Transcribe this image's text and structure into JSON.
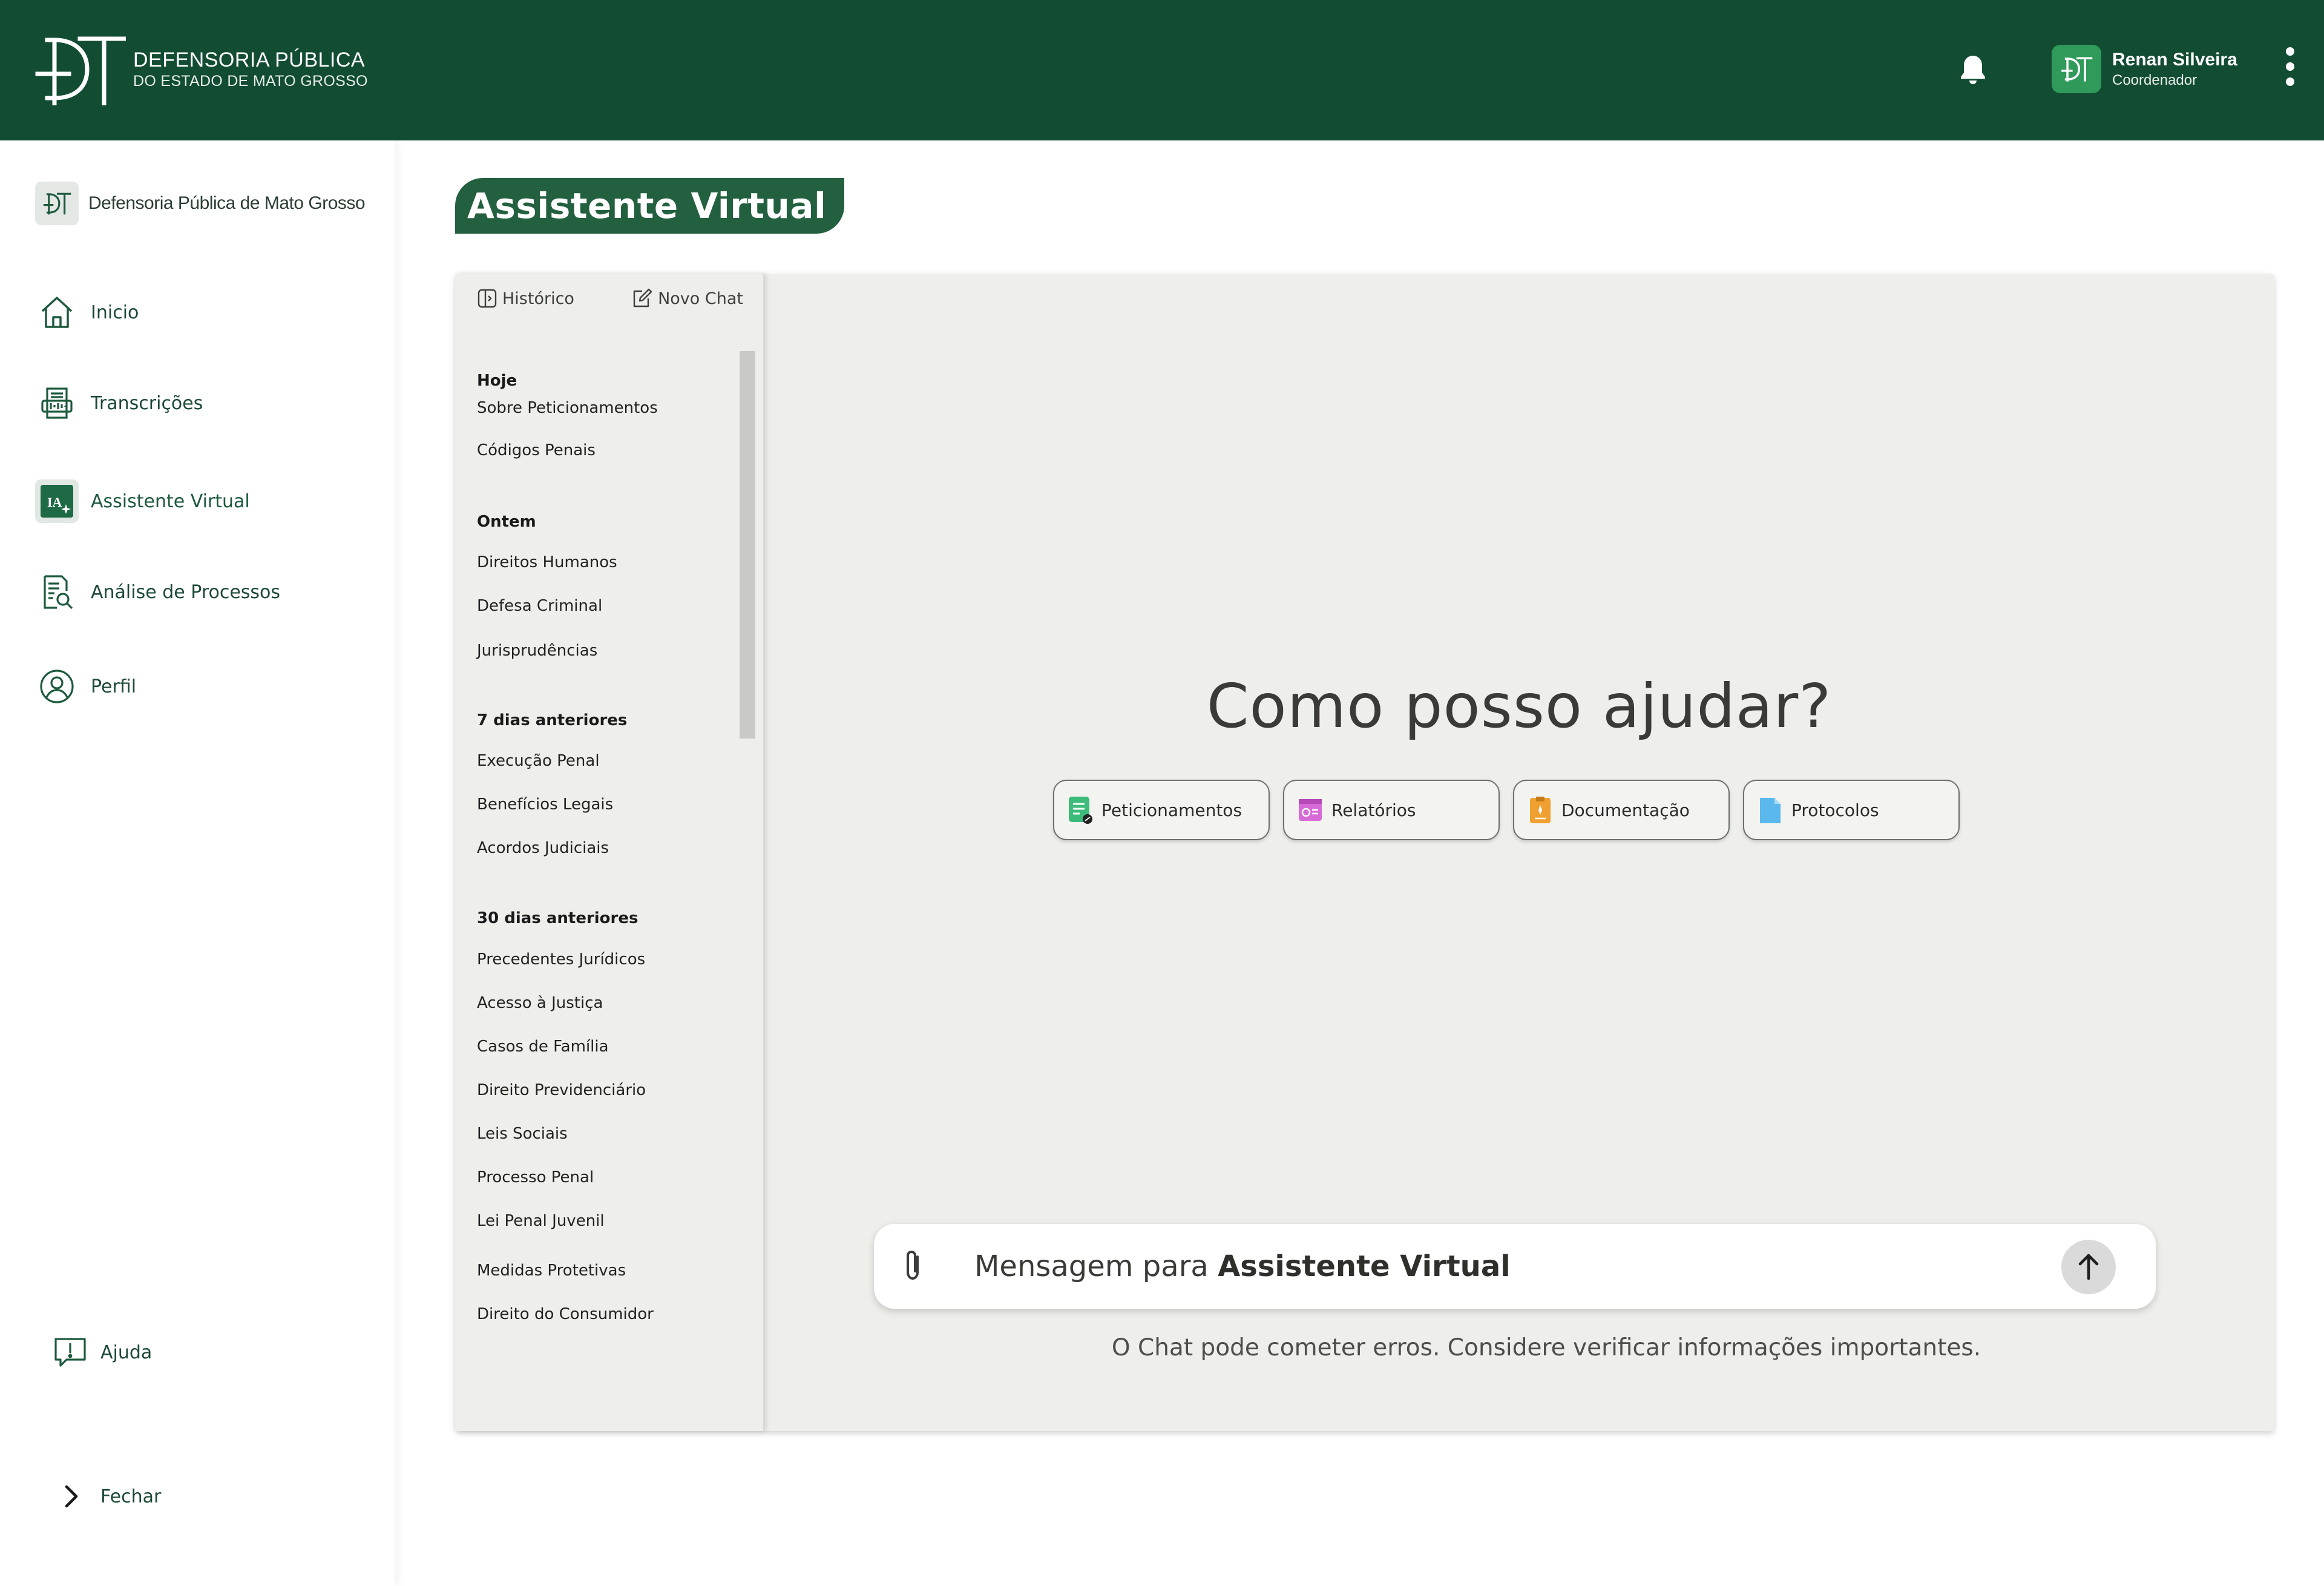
{
  "header": {
    "brand_title": "DEFENSORIA PÚBLICA",
    "brand_subtitle": "DO ESTADO DE MATO GROSSO",
    "user_name": "Renan Silveira",
    "user_role": "Coordenador",
    "icons": {
      "notifications": "bell-icon",
      "menu": "kebab-menu-icon",
      "avatar": "dpmt-logo-icon"
    }
  },
  "sidebar": {
    "org_name": "Defensoria Pública de Mato Grosso",
    "items": [
      {
        "label": "Inicio",
        "icon": "home-icon",
        "active": false
      },
      {
        "label": "Transcrições",
        "icon": "transcription-icon",
        "active": false
      },
      {
        "label": "Assistente Virtual",
        "icon": "ai-icon",
        "active": true
      },
      {
        "label": "Análise de Processos",
        "icon": "document-search-icon",
        "active": false
      },
      {
        "label": "Perfil",
        "icon": "user-circle-icon",
        "active": false
      }
    ],
    "help_label": "Ajuda",
    "close_label": "Fechar"
  },
  "page": {
    "title": "Assistente Virtual"
  },
  "history": {
    "history_label": "Histórico",
    "new_chat_label": "Novo Chat",
    "groups": [
      {
        "title": "Hoje",
        "items": [
          "Sobre Peticionamentos",
          "Códigos Penais"
        ]
      },
      {
        "title": "Ontem",
        "items": [
          "Direitos Humanos",
          "Defesa Criminal",
          "Jurisprudências"
        ]
      },
      {
        "title": "7 dias anteriores",
        "items": [
          "Execução Penal",
          "Benefícios Legais",
          "Acordos Judiciais"
        ]
      },
      {
        "title": "30 dias anteriores",
        "items": [
          "Precedentes Jurídicos",
          "Acesso à Justiça",
          "Casos de Família",
          "Direito Previdenciário",
          "Leis Sociais",
          "Processo Penal",
          "Lei Penal Juvenil",
          "Medidas Protetivas",
          "Direito do Consumidor"
        ]
      }
    ]
  },
  "chat": {
    "hero": "Como posso ajudar?",
    "suggestions": [
      {
        "label": "Peticionamentos",
        "icon": "petition-icon",
        "color": "#3dbb7a"
      },
      {
        "label": "Relatórios",
        "icon": "report-icon",
        "color": "#d86ad8"
      },
      {
        "label": "Documentação",
        "icon": "documentation-icon",
        "color": "#f0a030"
      },
      {
        "label": "Protocolos",
        "icon": "protocol-icon",
        "color": "#5ab8ec"
      }
    ],
    "input_prefix": "Mensagem para ",
    "input_bold": "Assistente Virtual",
    "disclaimer": "O Chat pode cometer erros. Considere verificar informações importantes."
  },
  "colors": {
    "primary": "#124d33",
    "accent": "#23603f",
    "panel": "#eeefeb"
  }
}
